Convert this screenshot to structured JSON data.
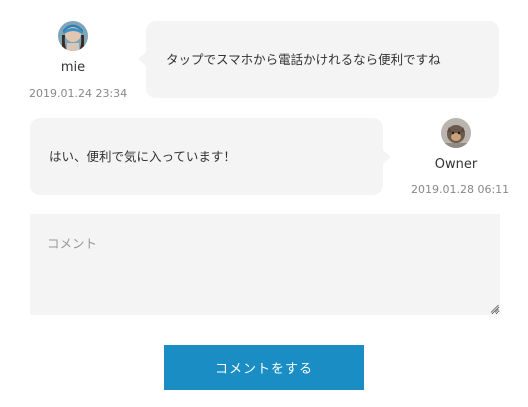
{
  "comments": [
    {
      "author": "mie",
      "avatar_icon": "user-avatar-blue-hat-icon",
      "date": "2019.01.24 23:34",
      "text": "タップでスマホから電話かけれるなら便利ですね"
    },
    {
      "author": "Owner",
      "avatar_icon": "owner-avatar-icon",
      "date": "2019.01.28 06:11",
      "text": "はい、便利で気に入っています！"
    }
  ],
  "form": {
    "comment_placeholder": "コメント",
    "submit_label": "コメントをする"
  },
  "colors": {
    "bubble_bg": "#f4f4f4",
    "button_bg": "#1a8ec4",
    "button_text": "#ffffff",
    "date_text": "#888888"
  }
}
